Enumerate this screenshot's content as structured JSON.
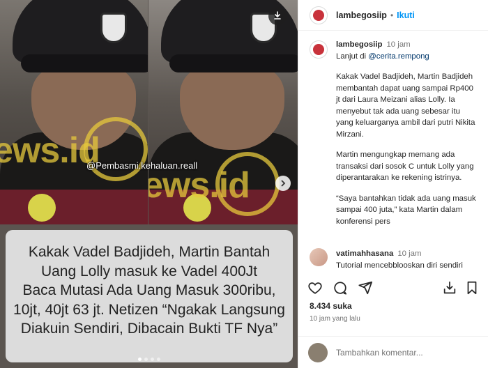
{
  "media": {
    "overlay_handle": "@Pembasmi.kehaluan.reall",
    "watermark_text": "ews.id",
    "caption_lines": [
      "Kakak Vadel Badjideh, Martin Bantah",
      "Uang Lolly masuk ke Vadel 400Jt",
      "Baca Mutasi Ada Uang Masuk 300ribu,",
      "10jt, 40jt 63 jt. Netizen “Ngakak Langsung",
      "Diakuin Sendiri, Dibacain Bukti TF Nya”"
    ],
    "download_icon": "download-icon",
    "next_icon": "chevron-right-icon",
    "slide_count": 4,
    "active_slide": 1
  },
  "header": {
    "username": "lambegosiip",
    "separator": "•",
    "follow_label": "Ikuti"
  },
  "post": {
    "username": "lambegosiip",
    "time": "10 jam",
    "first_line_prefix": "Lanjut di ",
    "mention": "@cerita.rempong",
    "paragraphs": [
      "Kakak Vadel Badjideh, Martin Badjideh membantah dapat uang sampai Rp400 jt dari Laura Meizani alias Lolly. Ia menyebut tak ada uang sebesar itu yang keluarganya ambil dari putri Nikita Mirzani.",
      "Martin mengungkap memang ada transaksi dari sosok C untuk Lolly yang diperantarakan ke rekening istrinya.",
      "“Saya bantahkan tidak ada uang masuk sampai 400 juta,” kata Martin dalam konferensi pers"
    ]
  },
  "comment": {
    "username": "vatimahhasana",
    "time": "10 jam",
    "text": "Tutorial mencebblooskan diri sendiri"
  },
  "actions": {
    "icons": [
      "heart-icon",
      "comment-icon",
      "share-icon",
      "save-icon"
    ]
  },
  "likes": "8.434 suka",
  "posted_ago": "10 jam yang lalu",
  "add_comment": {
    "placeholder": "Tambahkan komentar..."
  },
  "colors": {
    "link_blue": "#0095f6",
    "mention_blue": "#00376b",
    "caption_bg": "#dcdcdc",
    "watermark": "#e6c83c"
  }
}
